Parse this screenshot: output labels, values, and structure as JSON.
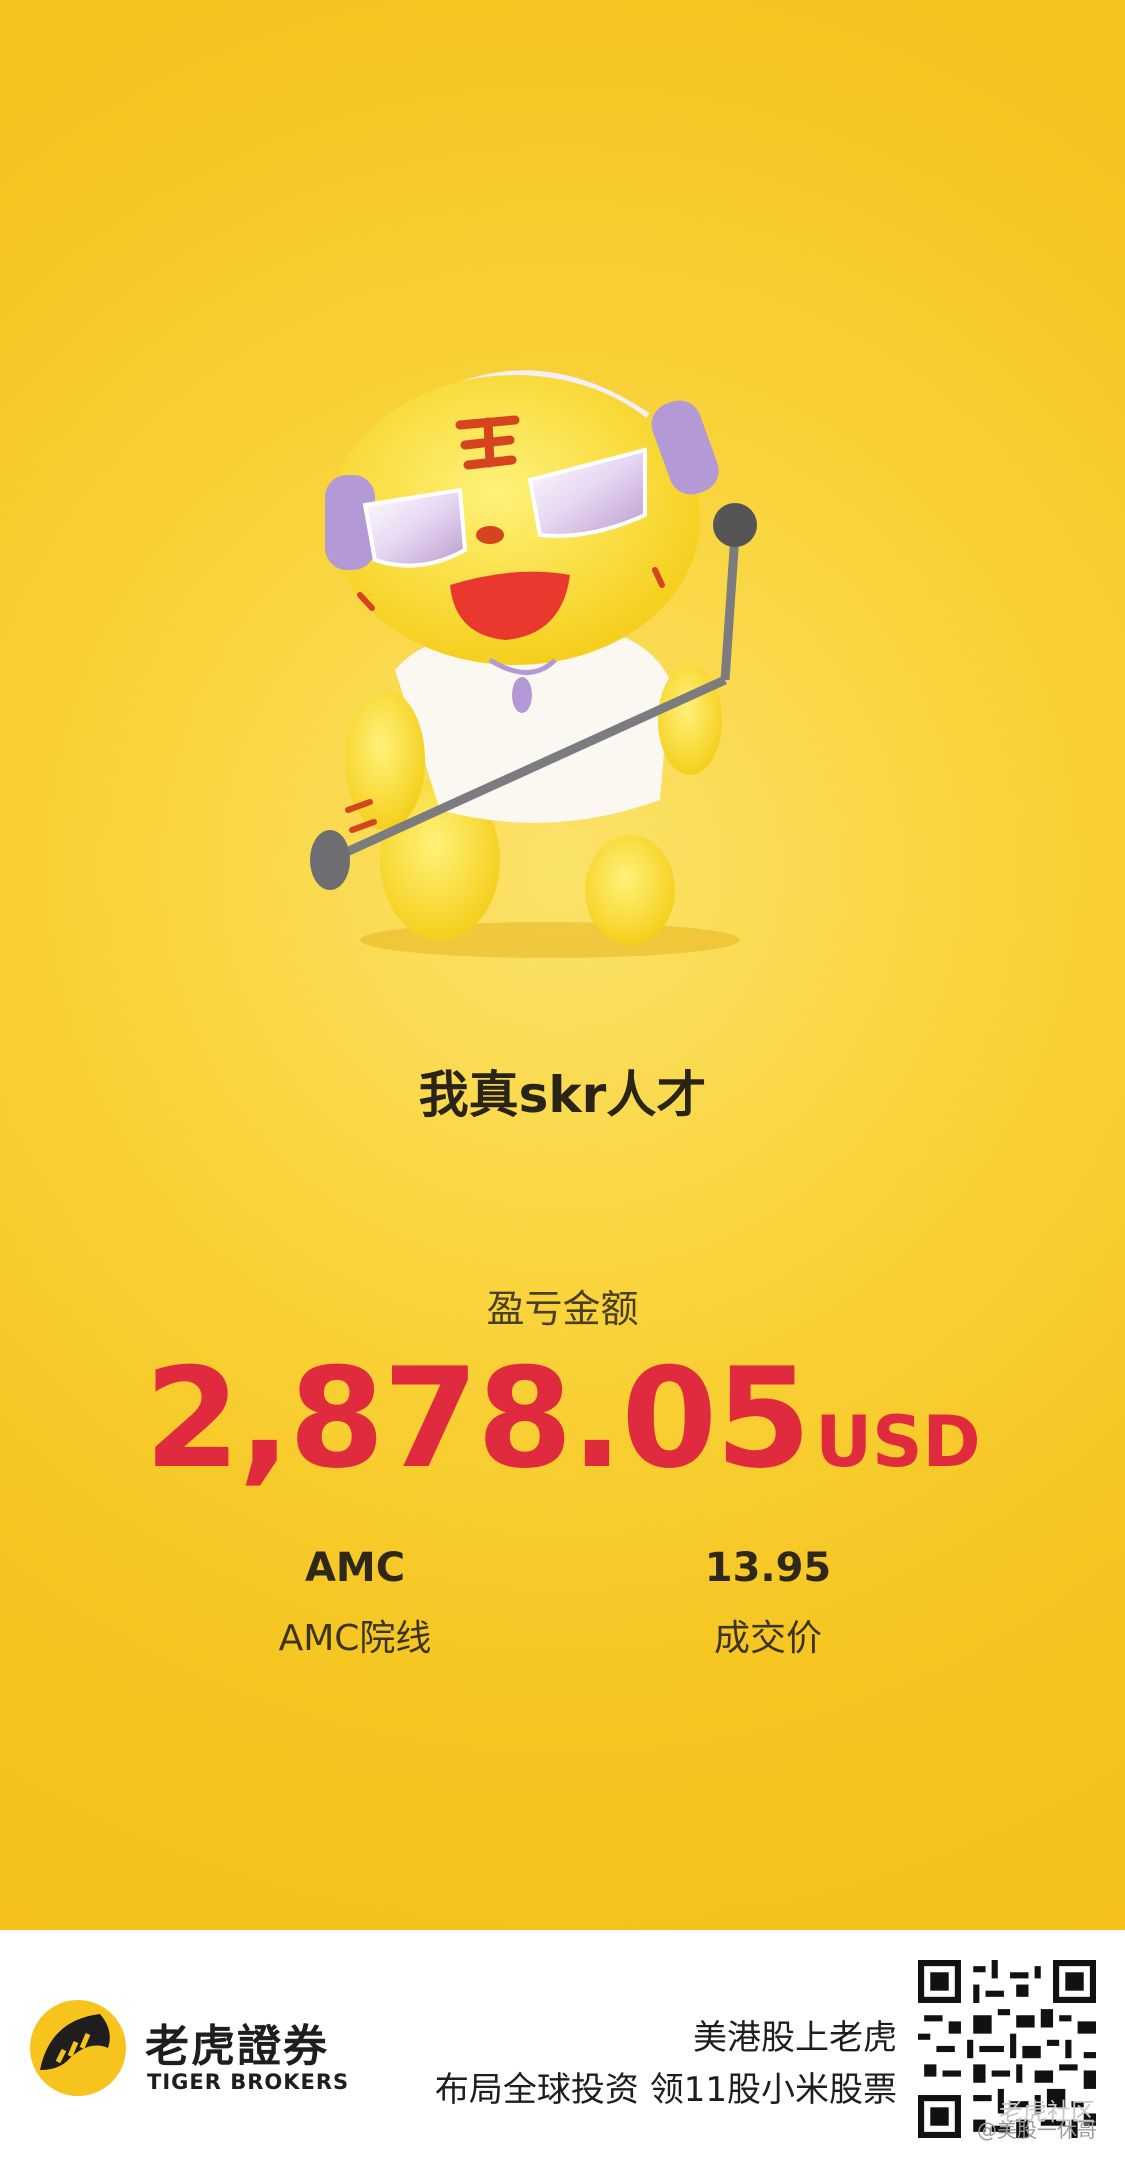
{
  "slogan": "我真skr人才",
  "pnl": {
    "label": "盈亏金额",
    "amount": "2,878.05",
    "currency": "USD"
  },
  "stock": {
    "ticker": "AMC",
    "name": "AMC院线"
  },
  "trade": {
    "price": "13.95",
    "price_label": "成交价"
  },
  "footer": {
    "brand_cn": "老虎證券",
    "brand_en": "TIGER BROKERS",
    "promo_line1": "美港股上老虎",
    "promo_line2": "布局全球投资 领11股小米股票",
    "watermark_top": "老虎社区",
    "watermark_bottom": "@美股一休哥"
  },
  "colors": {
    "background": "#f7c92a",
    "amount": "#e02b3f",
    "footer_bg": "#ffffff"
  },
  "icons": {
    "mascot": "tiger-mascot-with-headphones-and-microphone",
    "logo": "tiger-brokers-logo-icon",
    "qr": "qr-code"
  }
}
